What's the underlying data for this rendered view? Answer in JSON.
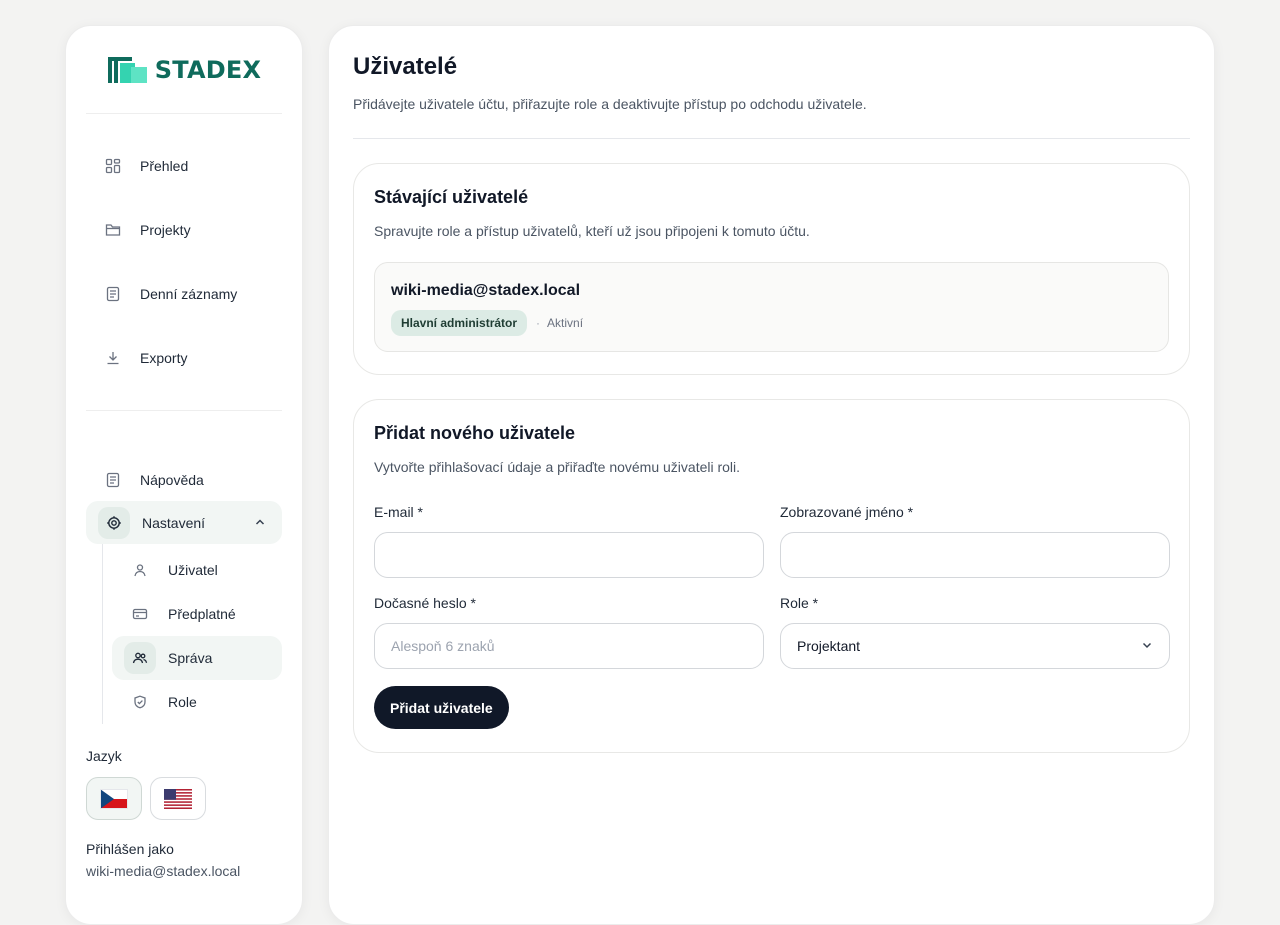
{
  "brand": {
    "name": "STADEX",
    "color": "#0f6b5c",
    "accent": "#34d3b0"
  },
  "sidebar": {
    "nav_top": [
      {
        "label": "Přehled",
        "icon": "grid-icon"
      },
      {
        "label": "Projekty",
        "icon": "folder-icon"
      },
      {
        "label": "Denní záznamy",
        "icon": "document-icon"
      },
      {
        "label": "Exporty",
        "icon": "download-icon"
      }
    ],
    "help": {
      "label": "Nápověda",
      "icon": "document-icon"
    },
    "settings": {
      "label": "Nastavení",
      "icon": "gear-icon",
      "expanded": true
    },
    "settings_children": [
      {
        "label": "Uživatel",
        "icon": "user-icon"
      },
      {
        "label": "Předplatné",
        "icon": "card-icon"
      },
      {
        "label": "Správa",
        "icon": "users-icon",
        "active": true
      },
      {
        "label": "Role",
        "icon": "shield-icon"
      }
    ],
    "language_label": "Jazyk",
    "languages": [
      {
        "code": "cs",
        "flag": "czech-flag",
        "active": true
      },
      {
        "code": "en",
        "flag": "us-flag",
        "active": false
      }
    ],
    "logged_in_label": "Přihlášen jako",
    "logged_in_email": "wiki-media@stadex.local"
  },
  "main": {
    "title": "Uživatelé",
    "subtitle": "Přidávejte uživatele účtu, přiřazujte role a deaktivujte přístup po odchodu uživatele.",
    "existing": {
      "title": "Stávající uživatelé",
      "subtitle": "Spravujte role a přístup uživatelů, kteří už jsou připojeni k tomuto účtu.",
      "users": [
        {
          "email": "wiki-media@stadex.local",
          "role": "Hlavní administrátor",
          "separator": "·",
          "status": "Aktivní"
        }
      ]
    },
    "add": {
      "title": "Přidat nového uživatele",
      "subtitle": "Vytvořte přihlašovací údaje a přiřaďte novému uživateli roli.",
      "email_label": "E-mail *",
      "email_value": "",
      "name_label": "Zobrazované jméno *",
      "name_value": "",
      "password_label": "Dočasné heslo *",
      "password_placeholder": "Alespoň 6 znaků",
      "role_label": "Role *",
      "role_value": "Projektant",
      "submit_label": "Přidat uživatele"
    }
  }
}
